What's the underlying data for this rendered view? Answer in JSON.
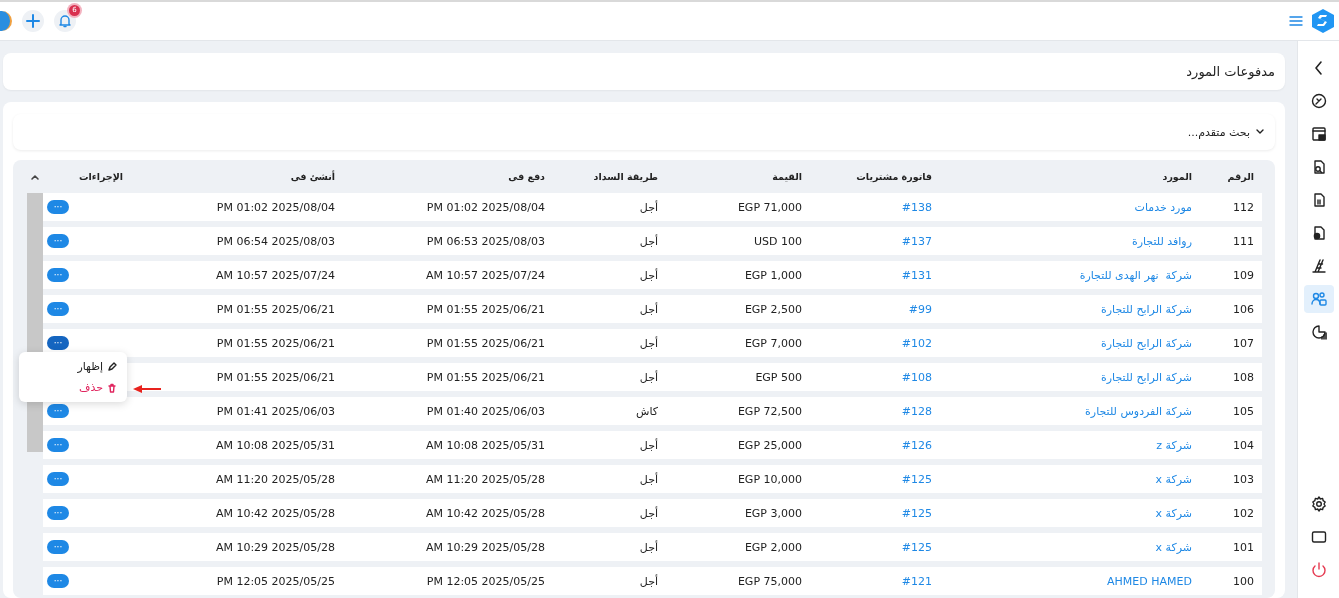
{
  "topbar": {
    "notifications": {
      "count": "6"
    }
  },
  "sidebar": {
    "items": [
      {
        "kind": "collapse",
        "selected": false
      },
      {
        "kind": "dashboard",
        "selected": false
      },
      {
        "kind": "store",
        "selected": false
      },
      {
        "kind": "doc-search",
        "selected": false
      },
      {
        "kind": "doc-link",
        "selected": false
      },
      {
        "kind": "doc-chart",
        "selected": false
      },
      {
        "kind": "stock",
        "selected": false
      },
      {
        "kind": "suppliers",
        "selected": true
      },
      {
        "kind": "reports",
        "selected": false
      }
    ],
    "bottom": [
      {
        "kind": "settings"
      },
      {
        "kind": "screen"
      },
      {
        "kind": "power"
      }
    ]
  },
  "page_title": "مدفوعات المورد",
  "advanced_search": {
    "label": "بحث متقدم...",
    "expanded": false
  },
  "table": {
    "columns": [
      "الرقم",
      "المورد",
      "فاتورة مشتريات",
      "القيمة",
      "طريقة السداد",
      "دفع فى",
      "أنشئ فى",
      "الإجراءات"
    ],
    "rows": [
      {
        "id": "112",
        "supplier": "مورد خدمات",
        "invoice": "#138",
        "amount": "EGP 71,000",
        "method": "أجل",
        "paid_at": "PM 01:02 2025/08/04",
        "created_at": "PM 01:02 2025/08/04",
        "action": {
          "label": "···",
          "selected": false
        }
      },
      {
        "id": "111",
        "supplier": "روافد للتجارة",
        "invoice": "#137",
        "amount": "USD 100",
        "method": "أجل",
        "paid_at": "PM 06:53 2025/08/03",
        "created_at": "PM 06:54 2025/08/03",
        "action": {
          "label": "···",
          "selected": false
        }
      },
      {
        "id": "109",
        "supplier": "شركة  نهر الهدى للتجارة",
        "invoice": "#131",
        "amount": "EGP 1,000",
        "method": "أجل",
        "paid_at": "AM 10:57 2025/07/24",
        "created_at": "AM 10:57 2025/07/24",
        "action": {
          "label": "···",
          "selected": false
        }
      },
      {
        "id": "106",
        "supplier": "شركة الرابح للتجارة",
        "invoice": "#99",
        "amount": "EGP 2,500",
        "method": "أجل",
        "paid_at": "PM 01:55 2025/06/21",
        "created_at": "PM 01:55 2025/06/21",
        "action": {
          "label": "···",
          "selected": false
        }
      },
      {
        "id": "107",
        "supplier": "شركة الرابح للتجارة",
        "invoice": "#102",
        "amount": "EGP 7,000",
        "method": "أجل",
        "paid_at": "PM 01:55 2025/06/21",
        "created_at": "PM 01:55 2025/06/21",
        "action": {
          "label": "···",
          "selected": true
        }
      },
      {
        "id": "108",
        "supplier": "شركة الرابح للتجارة",
        "invoice": "#108",
        "amount": "EGP 500",
        "method": "أجل",
        "paid_at": "PM 01:55 2025/06/21",
        "created_at": "PM 01:55 2025/06/21"
      },
      {
        "id": "105",
        "supplier": "شركة الفردوس للتجارة",
        "invoice": "#128",
        "amount": "EGP 72,500",
        "method": "كاش",
        "paid_at": "PM 01:40 2025/06/03",
        "created_at": "PM 01:41 2025/06/03",
        "action": {
          "label": "···",
          "selected": false
        }
      },
      {
        "id": "104",
        "supplier": "شركة z",
        "invoice": "#126",
        "amount": "EGP 25,000",
        "method": "أجل",
        "paid_at": "AM 10:08 2025/05/31",
        "created_at": "AM 10:08 2025/05/31",
        "action": {
          "label": "···",
          "selected": false
        }
      },
      {
        "id": "103",
        "supplier": "شركة x",
        "invoice": "#125",
        "amount": "EGP 10,000",
        "method": "أجل",
        "paid_at": "AM 11:20 2025/05/28",
        "created_at": "AM 11:20 2025/05/28",
        "action": {
          "label": "···",
          "selected": false
        }
      },
      {
        "id": "102",
        "supplier": "شركة x",
        "invoice": "#125",
        "amount": "EGP 3,000",
        "method": "أجل",
        "paid_at": "AM 10:42 2025/05/28",
        "created_at": "AM 10:42 2025/05/28",
        "action": {
          "label": "···",
          "selected": false
        }
      },
      {
        "id": "101",
        "supplier": "شركة x",
        "invoice": "#125",
        "amount": "EGP 2,000",
        "method": "أجل",
        "paid_at": "AM 10:29 2025/05/28",
        "created_at": "AM 10:29 2025/05/28",
        "action": {
          "label": "···",
          "selected": false
        }
      },
      {
        "id": "100",
        "supplier": "AHMED HAMED",
        "invoice": "#121",
        "amount": "EGP 75,000",
        "method": "أجل",
        "paid_at": "PM 12:05 2025/05/25",
        "created_at": "PM 12:05 2025/05/25",
        "action": {
          "label": "···",
          "selected": false
        }
      }
    ]
  },
  "row_menu": {
    "items": [
      {
        "kind": "view",
        "label": "إظهار"
      },
      {
        "kind": "delete",
        "label": "حذف"
      }
    ]
  }
}
